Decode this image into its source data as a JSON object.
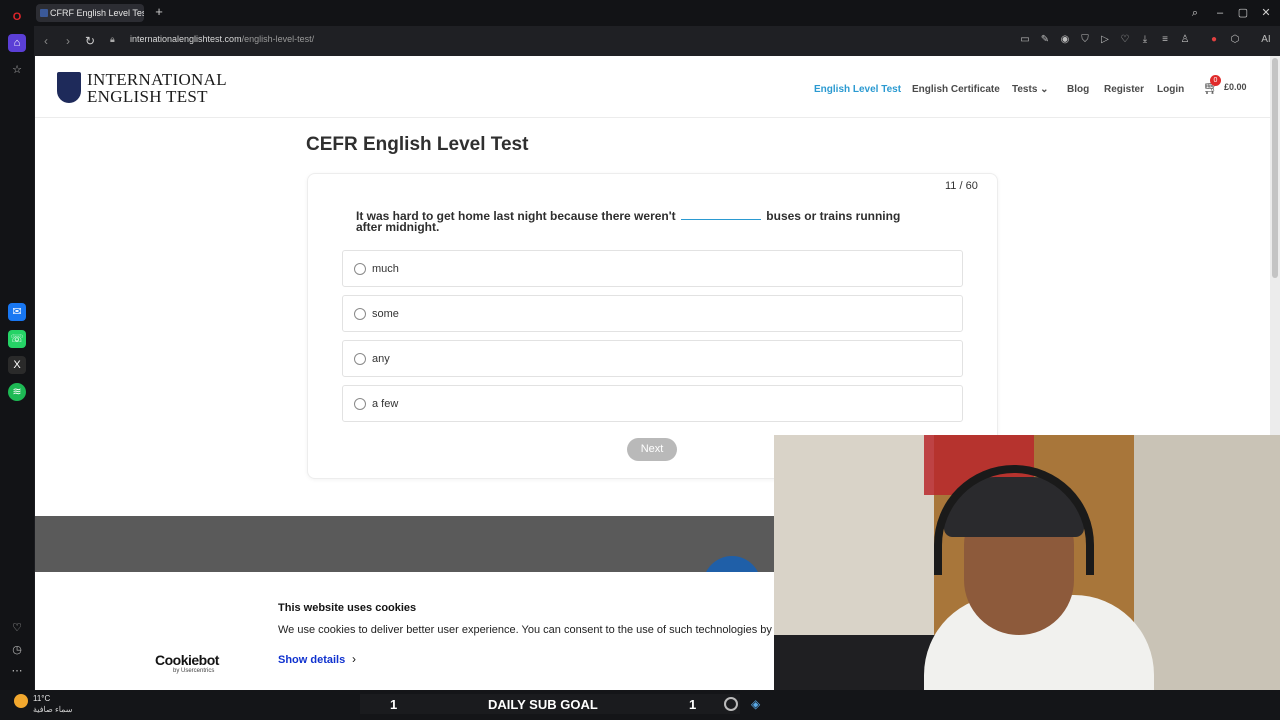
{
  "browser": {
    "tab_title": "CFRF English Level Test -",
    "url_domain": "internationalenglishtest.com",
    "url_path": "/english-level-test/",
    "new_tab": "+",
    "ai_label": "AI"
  },
  "site": {
    "logo_line1": "INTERNATIONAL",
    "logo_line2": "ENGLISH TEST",
    "nav": {
      "english_level_test": "English Level Test",
      "english_certificate": "English Certificate",
      "tests": "Tests",
      "blog": "Blog",
      "register": "Register",
      "login": "Login"
    },
    "cart_count": "0",
    "cart_total": "£0.00"
  },
  "quiz": {
    "title": "CEFR English Level Test",
    "counter": "11 / 60",
    "question_before": "It was hard to get home last night because there weren't",
    "question_after": "buses or trains running after midnight.",
    "options": [
      "much",
      "some",
      "any",
      "a few"
    ],
    "next_label": "Next"
  },
  "cookie": {
    "title": "This website uses cookies",
    "body": "We use cookies to deliver better user experience. You can consent to the use of such technologies by ac",
    "brand": "Cookiebot",
    "brand_sub": "by Usercentrics",
    "show_details": "Show details"
  },
  "stream": {
    "weather_temp": "11°C",
    "weather_desc": "سماء صافية",
    "goal_title": "DAILY SUB GOAL",
    "goal_current": "1",
    "goal_target": "1"
  },
  "colors": {
    "accent": "#2b9ad1",
    "show_details": "#1032cf"
  }
}
